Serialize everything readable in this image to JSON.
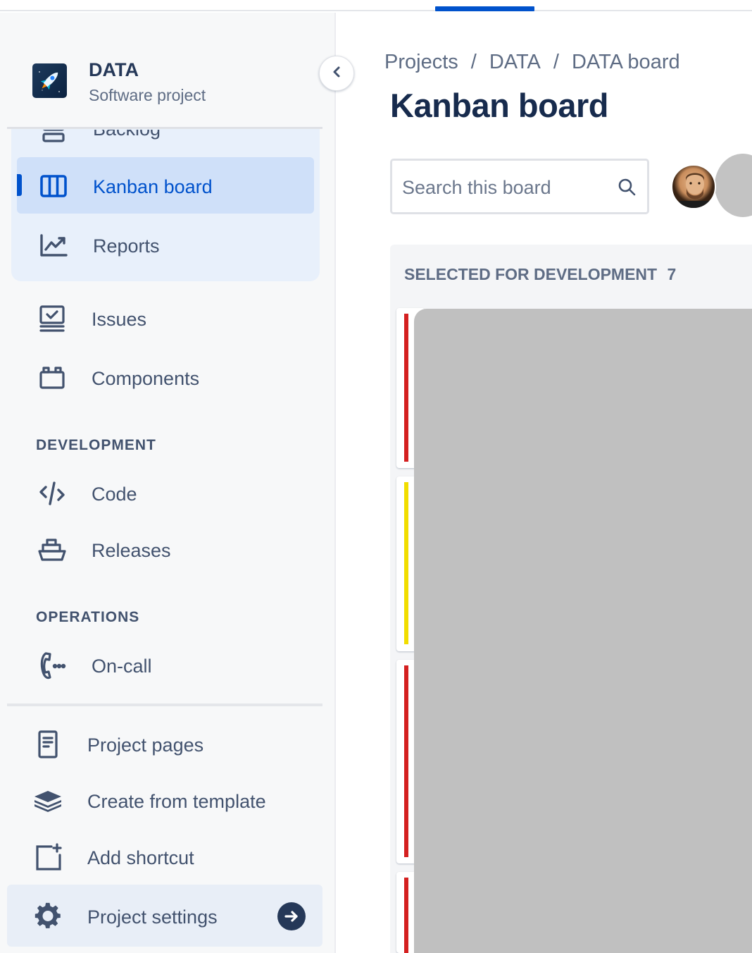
{
  "project": {
    "name": "DATA",
    "type": "Software project"
  },
  "sidebar": {
    "planning_items": [
      {
        "label": "Backlog",
        "icon": "backlog-icon"
      },
      {
        "label": "Kanban board",
        "icon": "board-icon",
        "selected": true
      },
      {
        "label": "Reports",
        "icon": "reports-icon"
      }
    ],
    "items": [
      {
        "label": "Issues",
        "icon": "issues-icon"
      },
      {
        "label": "Components",
        "icon": "components-icon"
      }
    ],
    "development_title": "DEVELOPMENT",
    "development_items": [
      {
        "label": "Code",
        "icon": "code-icon"
      },
      {
        "label": "Releases",
        "icon": "releases-icon"
      }
    ],
    "operations_title": "OPERATIONS",
    "operations_items": [
      {
        "label": "On-call",
        "icon": "on-call-icon"
      }
    ],
    "footer_items": [
      {
        "label": "Project pages",
        "icon": "project-pages-icon"
      },
      {
        "label": "Create from template",
        "icon": "template-icon"
      },
      {
        "label": "Add shortcut",
        "icon": "add-shortcut-icon"
      },
      {
        "label": "Project settings",
        "icon": "gear-icon"
      }
    ]
  },
  "breadcrumbs": [
    "Projects",
    "DATA",
    "DATA board"
  ],
  "breadcrumb_separator": "/",
  "page_title": "Kanban board",
  "search": {
    "placeholder": "Search this board"
  },
  "board": {
    "columns": [
      {
        "title": "SELECTED FOR DEVELOPMENT",
        "count": "7"
      }
    ],
    "cards": [
      {
        "priority_color": "#d42020"
      },
      {
        "priority_color": "#f1dd00"
      },
      {
        "priority_color": "#d42020"
      },
      {
        "priority_color": "#d42020"
      }
    ]
  },
  "colors": {
    "accent": "#0052cc",
    "selected_bg": "#cfe0f9",
    "text_primary": "#172b4d",
    "text_secondary": "#42526e"
  }
}
